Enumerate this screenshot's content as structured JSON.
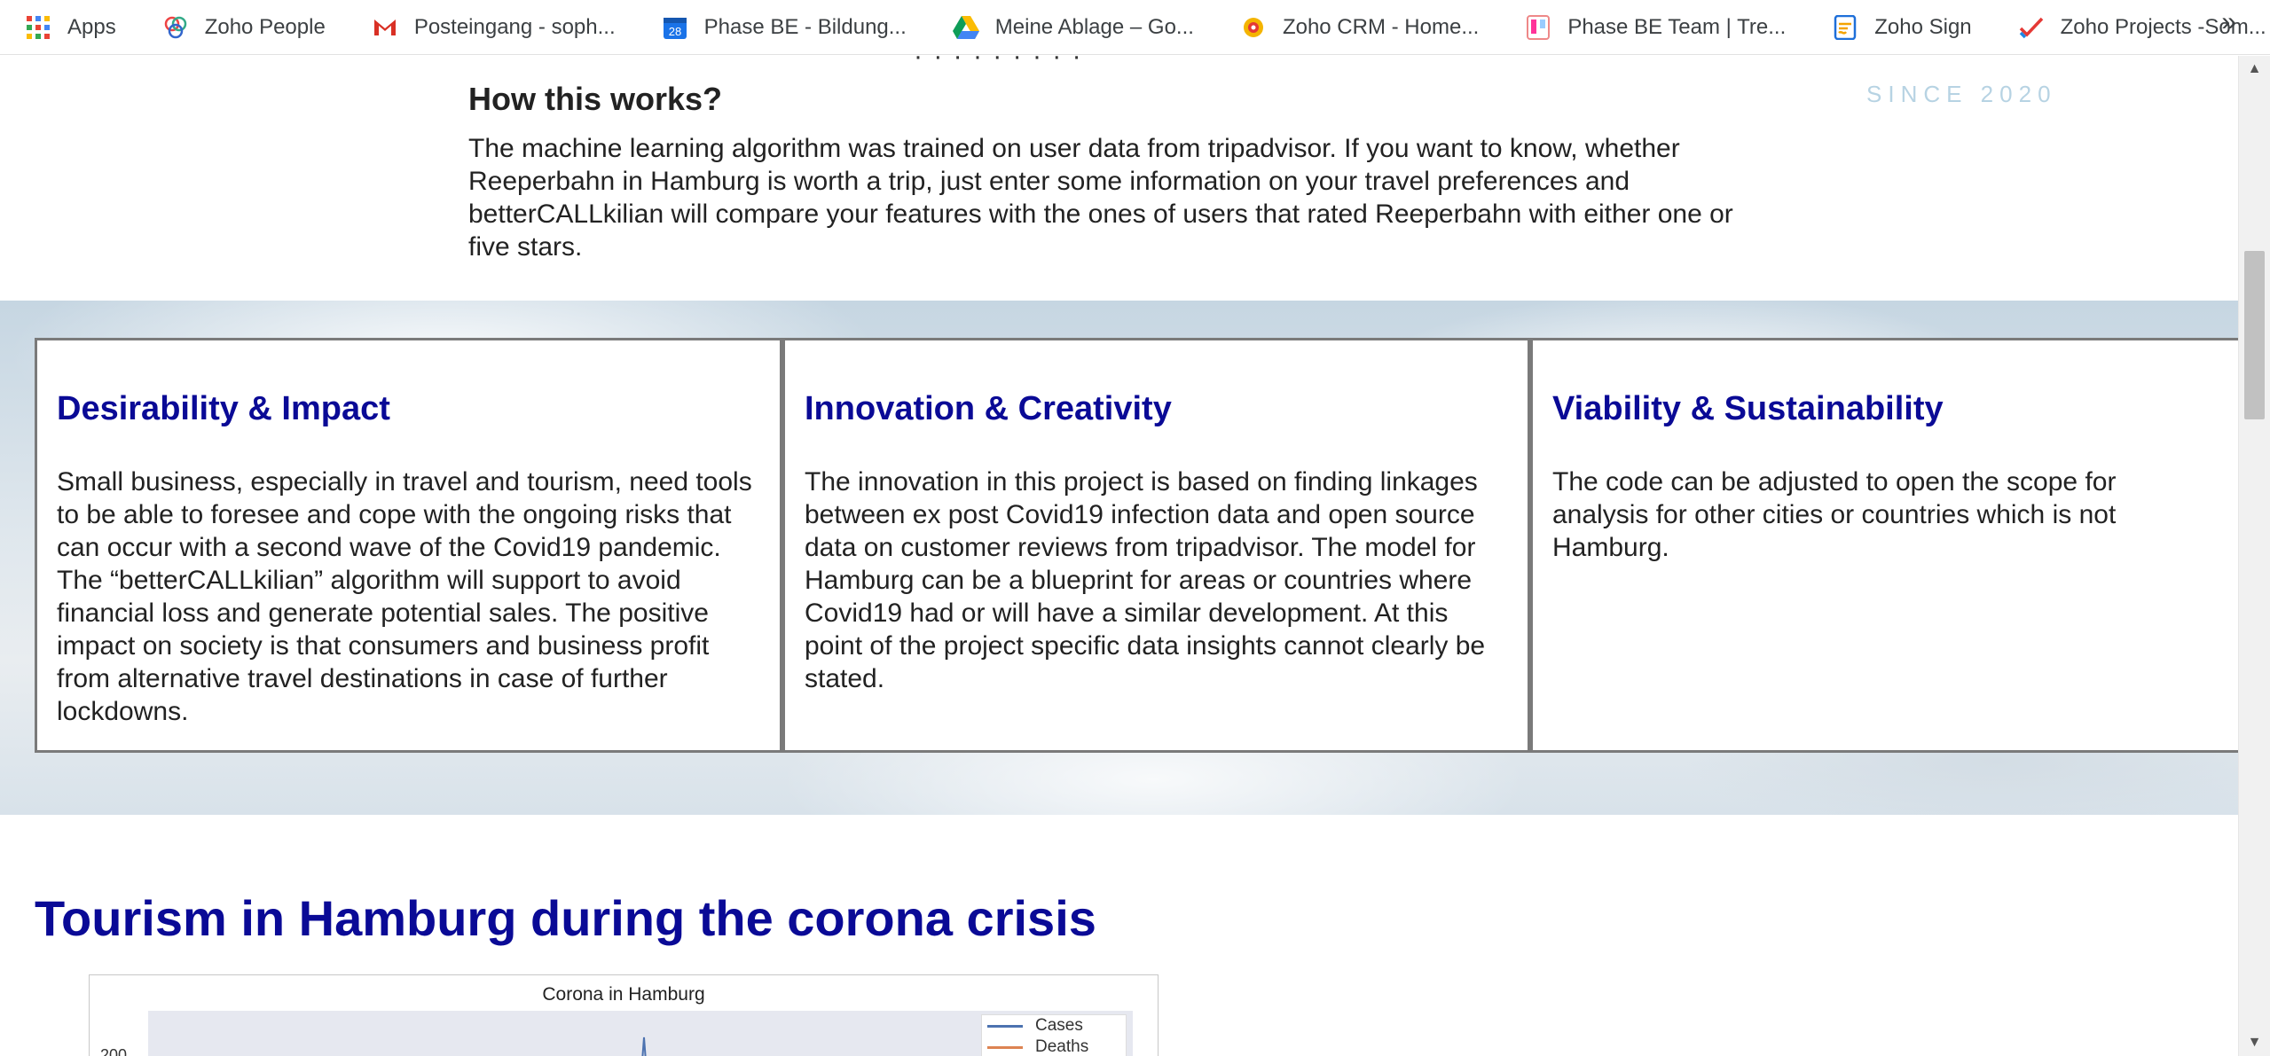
{
  "bookmarks": [
    {
      "label": "Apps",
      "icon": "apps-grid-icon"
    },
    {
      "label": "Zoho People",
      "icon": "zoho-people-icon"
    },
    {
      "label": "Posteingang - soph...",
      "icon": "gmail-icon"
    },
    {
      "label": "Phase BE - Bildung...",
      "icon": "calendar-icon",
      "badge": "28"
    },
    {
      "label": "Meine Ablage – Go...",
      "icon": "google-drive-icon"
    },
    {
      "label": "Zoho CRM - Home...",
      "icon": "zoho-crm-icon"
    },
    {
      "label": "Phase BE Team | Tre...",
      "icon": "trello-icon"
    },
    {
      "label": "Zoho Sign",
      "icon": "zoho-sign-icon"
    },
    {
      "label": "Zoho Projects -Som...",
      "icon": "zoho-projects-icon"
    }
  ],
  "bookmarks_more": "»",
  "since_label": "SINCE 2020",
  "cut_text": "· · · · · · · · ·",
  "how": {
    "title": "How this works?",
    "text": "The machine learning algorithm was trained on user data from tripadvisor. If you want to know, whether Reeperbahn in Hamburg is worth a trip, just enter some information on your travel preferences and betterCALLkilian will compare your features with the ones of users that rated Reeperbahn with either one or five stars."
  },
  "cards": [
    {
      "title": "Desirability & Impact",
      "text": "Small business, especially in travel and tourism, need tools to be able to foresee and cope with the ongoing risks that can occur with a second wave of the Covid19 pandemic. The “betterCALLkilian” algorithm will support to avoid financial loss and generate potential sales. The positive impact on society is that consumers and business profit from alternative travel destinations in case of further lockdowns."
    },
    {
      "title": "Innovation & Creativity",
      "text": "The innovation in this project is based on finding linkages between ex post Covid19 infection data and open source data on customer reviews from tripadvisor. The model for Hamburg can be a blueprint for areas or countries where Covid19 had or will have a similar development. At this point of the project specific data insights cannot clearly be stated."
    },
    {
      "title": "Viability & Sustainability",
      "text": "The code can be adjusted to open the scope for analysis for other cities or countries which is not Hamburg."
    }
  ],
  "section_title": "Tourism in Hamburg during the corona crisis",
  "chart_data": {
    "type": "line",
    "title": "Corona in Hamburg",
    "ytick_visible": "200",
    "series": [
      {
        "name": "Cases",
        "color": "#4c72b0"
      },
      {
        "name": "Deaths",
        "color": "#dd8452"
      }
    ]
  },
  "colors": {
    "heading": "#0a0a96",
    "text": "#222222"
  }
}
